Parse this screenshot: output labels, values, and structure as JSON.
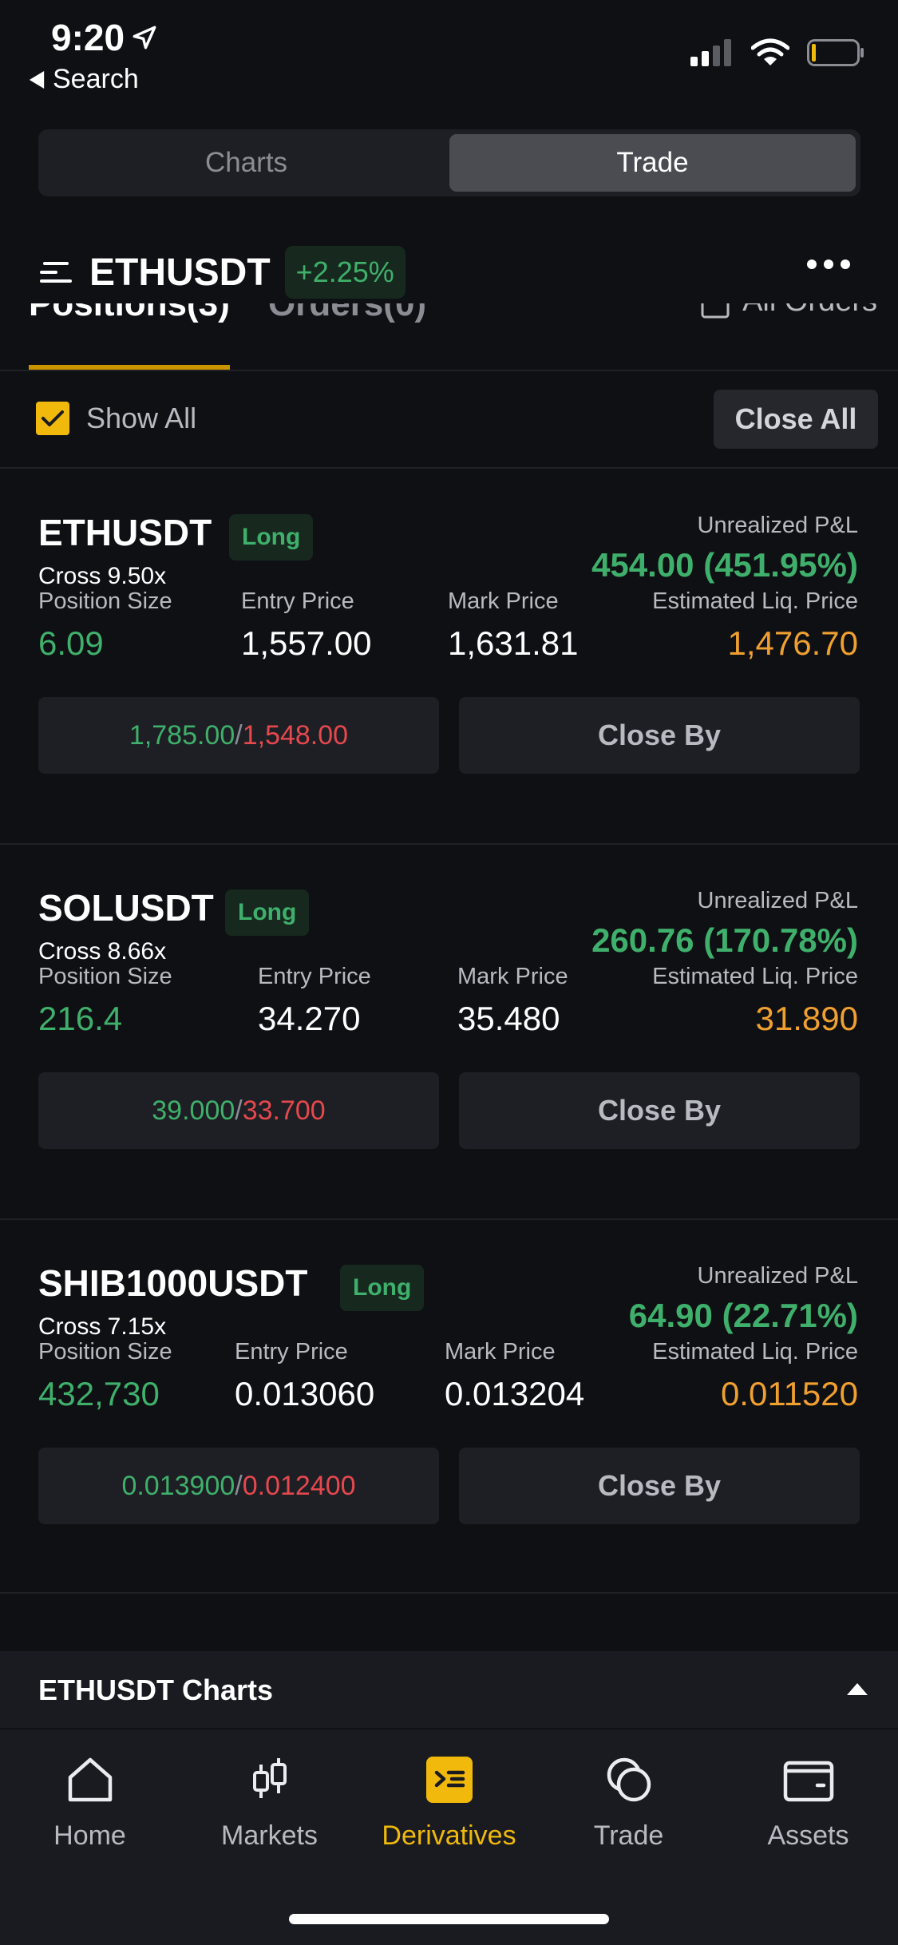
{
  "status_bar": {
    "time": "9:20",
    "back_label": "Search"
  },
  "segmented": {
    "charts": "Charts",
    "trade": "Trade",
    "active": "Trade"
  },
  "pair": {
    "name": "ETHUSDT",
    "change": "+2.25%"
  },
  "tabs": {
    "positions": "Positions(3)",
    "orders": "Orders(0)",
    "all_orders": "All Orders"
  },
  "filter": {
    "show_all": "Show All",
    "show_all_checked": true,
    "close_all": "Close All"
  },
  "labels": {
    "unrealized_pnl": "Unrealized P&L",
    "position_size": "Position Size",
    "entry_price": "Entry Price",
    "mark_price": "Mark Price",
    "est_liq_price": "Estimated Liq. Price",
    "close_by": "Close By",
    "tpsl_separator": "/"
  },
  "positions": [
    {
      "symbol": "ETHUSDT",
      "side": "Long",
      "leverage": "Cross 9.50x",
      "pnl": "454.00 (451.95%)",
      "size": "6.09",
      "entry": "1,557.00",
      "mark": "1,631.81",
      "liq": "1,476.70",
      "tp": "1,785.00",
      "sl": "1,548.00"
    },
    {
      "symbol": "SOLUSDT",
      "side": "Long",
      "leverage": "Cross 8.66x",
      "pnl": "260.76 (170.78%)",
      "size": "216.4",
      "entry": "34.270",
      "mark": "35.480",
      "liq": "31.890",
      "tp": "39.000",
      "sl": "33.700"
    },
    {
      "symbol": "SHIB1000USDT",
      "side": "Long",
      "leverage": "Cross 7.15x",
      "pnl": "64.90 (22.71%)",
      "size": "432,730",
      "entry": "0.013060",
      "mark": "0.013204",
      "liq": "0.011520",
      "tp": "0.013900",
      "sl": "0.012400"
    }
  ],
  "charts_bar": {
    "label": "ETHUSDT Charts"
  },
  "nav": [
    {
      "label": "Home",
      "icon": "home-icon"
    },
    {
      "label": "Markets",
      "icon": "candlestick-icon"
    },
    {
      "label": "Derivatives",
      "icon": "derivatives-icon",
      "active": true
    },
    {
      "label": "Trade",
      "icon": "trade-exchange-icon"
    },
    {
      "label": "Assets",
      "icon": "wallet-icon"
    }
  ],
  "colors": {
    "accent": "#f0b90b",
    "up": "#3fb06b",
    "down": "#e5484d",
    "liq": "#f0a030",
    "background": "#0f1013"
  }
}
